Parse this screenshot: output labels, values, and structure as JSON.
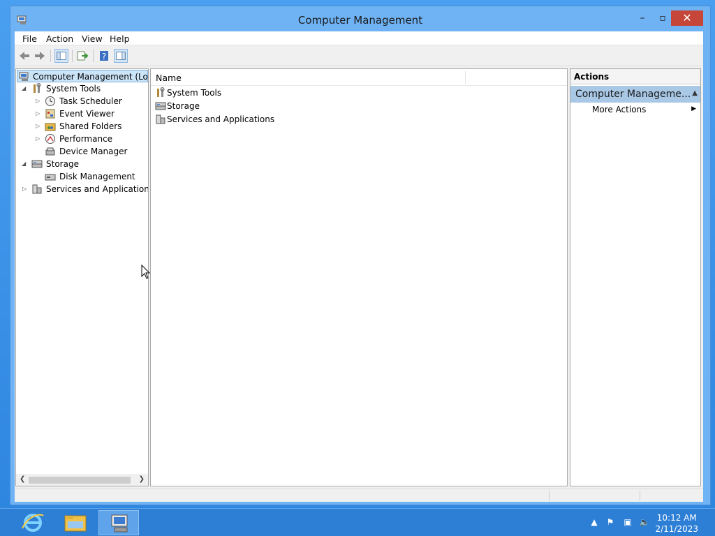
{
  "window": {
    "title": "Computer Management"
  },
  "menu": [
    "File",
    "Action",
    "View",
    "Help"
  ],
  "tree": {
    "root": "Computer Management (Local",
    "items": [
      "System Tools",
      "Task Scheduler",
      "Event Viewer",
      "Shared Folders",
      "Performance",
      "Device Manager",
      "Storage",
      "Disk Management",
      "Services and Applications"
    ]
  },
  "list": {
    "column_name": "Name",
    "rows": [
      "System Tools",
      "Storage",
      "Services and Applications"
    ]
  },
  "actions": {
    "header": "Actions",
    "section": "Computer Manageme...",
    "item": "More Actions"
  },
  "taskbar": {
    "time": "10:12 AM",
    "date": "2/11/2023"
  },
  "colors": {
    "accent": "#3a8ee6",
    "close_button": "#c7463a",
    "selection": "#cce4f7",
    "actions_section": "#a9c8e6"
  }
}
